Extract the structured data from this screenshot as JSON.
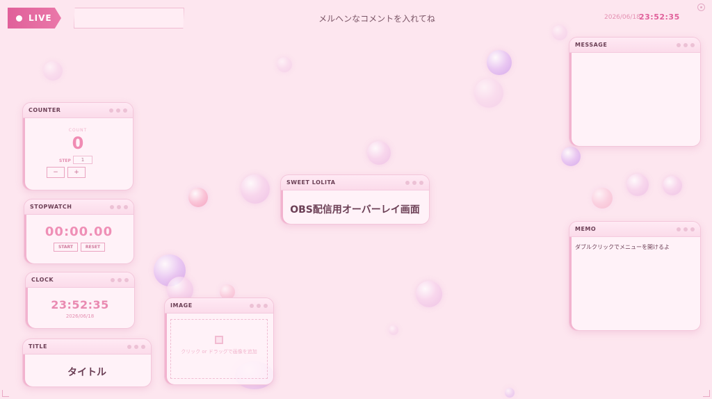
{
  "header": {
    "live_label": "LIVE",
    "headline": "メルヘンなコメントを入れてね",
    "date": "2026/06/18",
    "time": "23:52:35"
  },
  "counter": {
    "title": "COUNTER",
    "count_label": "COUNT",
    "count_value": "0",
    "step_label": "STEP",
    "step_value": "1",
    "minus_label": "−",
    "plus_label": "+"
  },
  "stopwatch": {
    "title": "STOPWATCH",
    "time": "00:00.00",
    "start_label": "START",
    "reset_label": "RESET"
  },
  "clock": {
    "title": "CLOCK",
    "time": "23:52:35",
    "date": "2026/06/18"
  },
  "title_widget": {
    "title": "TITLE",
    "text": "タイトル"
  },
  "image_widget": {
    "title": "IMAGE",
    "hint": "クリック or ドラッグで画像を追加"
  },
  "sweet_lolita": {
    "title": "SWEET LOLITA",
    "text": "OBS配信用オーバーレイ画面"
  },
  "message": {
    "title": "MESSAGE"
  },
  "memo": {
    "title": "MEMO",
    "text": "ダブルクリックでメニューを開けるよ"
  },
  "colors": {
    "accent": "#e0609a",
    "background": "#fde6ef",
    "text": "#6b3f55"
  },
  "icons": [
    "live-dot-icon",
    "gear-icon",
    "image-icon",
    "window-dots-icon"
  ]
}
